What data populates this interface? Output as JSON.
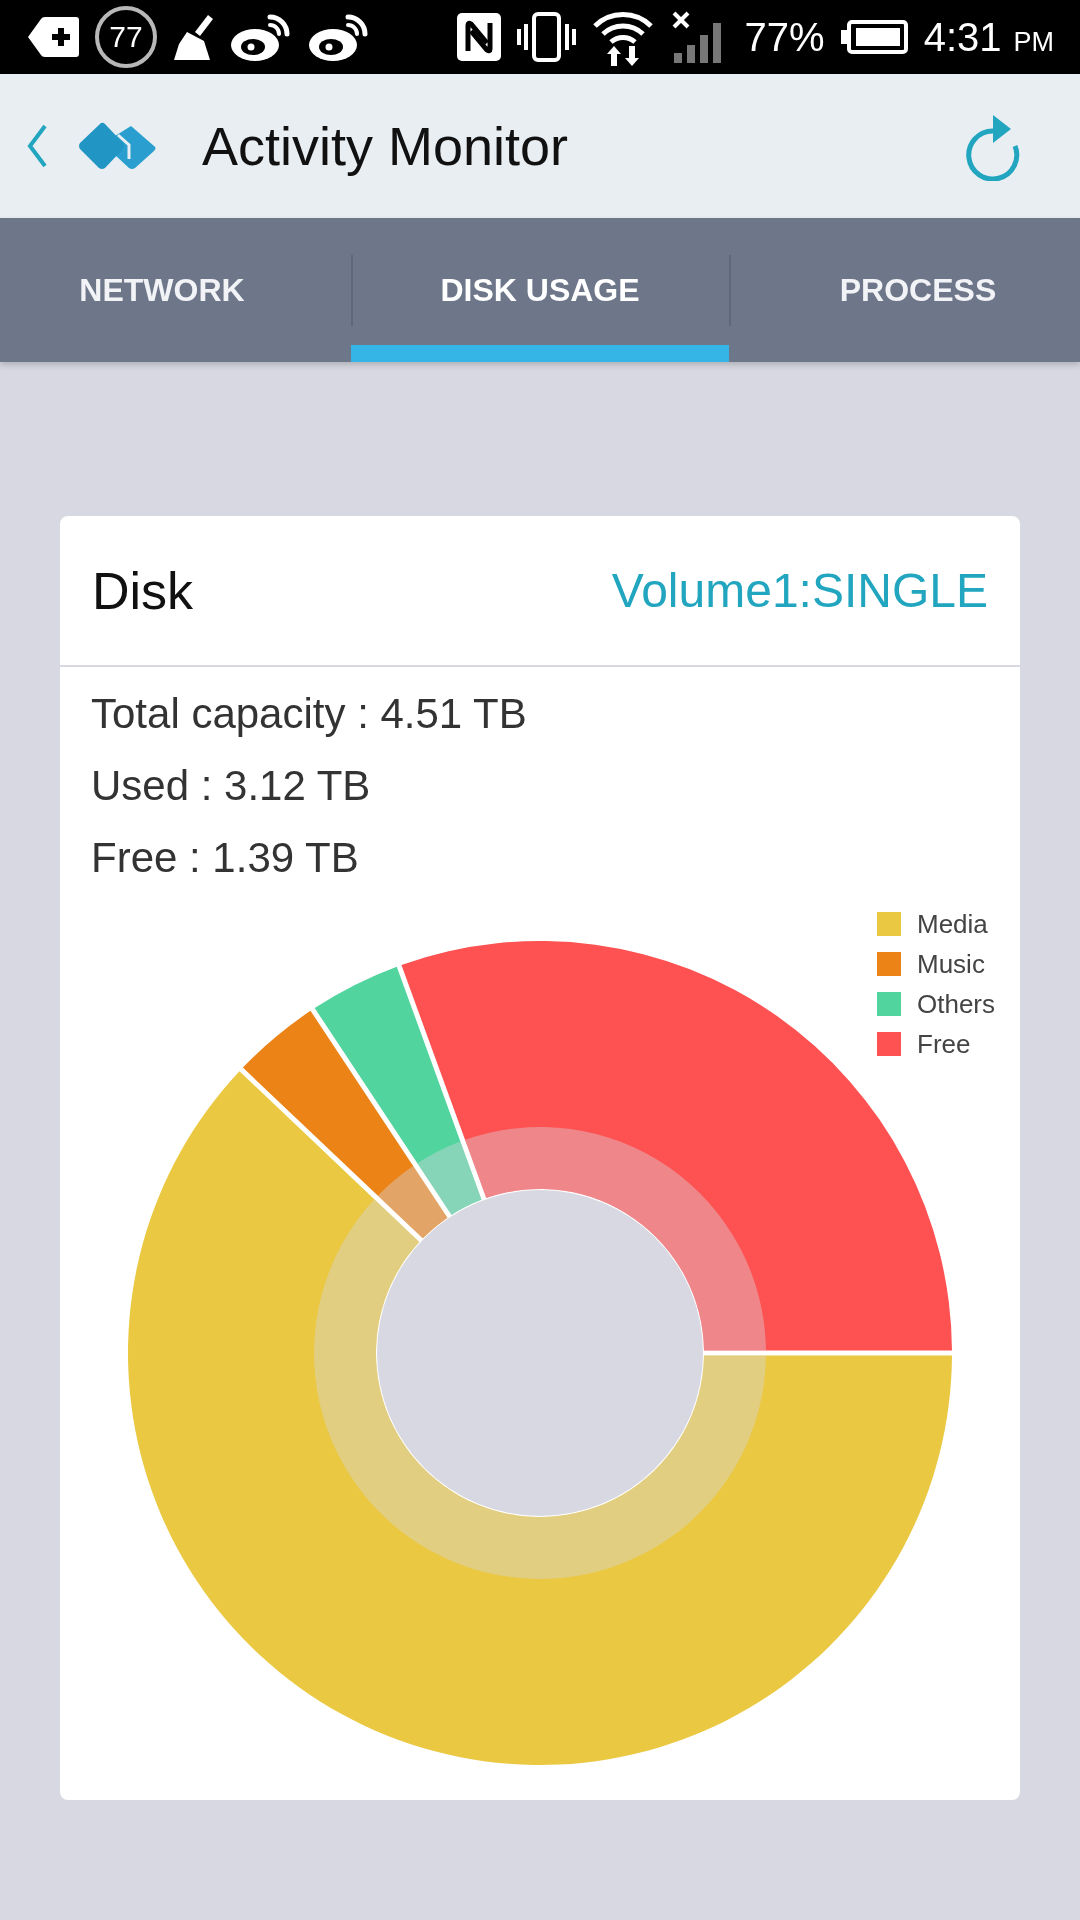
{
  "status_bar": {
    "badge": "77",
    "battery": "77%",
    "time": "4:31",
    "meridiem": "PM"
  },
  "app_bar": {
    "title": "Activity Monitor"
  },
  "tabs": [
    {
      "label": "NETWORK",
      "selected": false
    },
    {
      "label": "DISK USAGE",
      "selected": true
    },
    {
      "label": "PROCESS",
      "selected": false
    }
  ],
  "disk_card": {
    "title": "Disk",
    "volume": "Volume1:SINGLE",
    "stats": [
      "Total capacity : 4.51 TB",
      "Used : 3.12 TB",
      "Free : 1.39 TB"
    ],
    "legend": [
      {
        "label": "Media",
        "color": "#eac841"
      },
      {
        "label": "Music",
        "color": "#eb8316"
      },
      {
        "label": "Others",
        "color": "#52d49e"
      },
      {
        "label": "Free",
        "color": "#fe5151"
      }
    ]
  }
}
